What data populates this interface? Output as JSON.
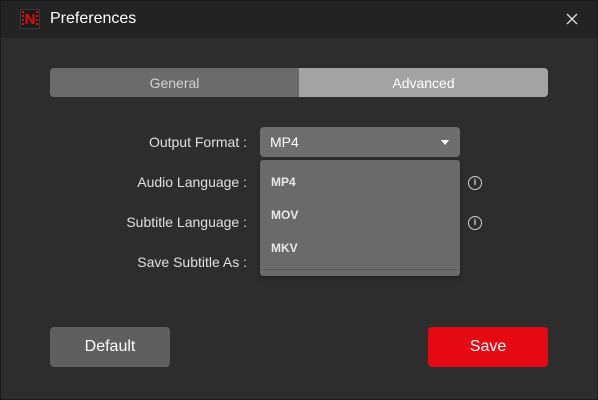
{
  "window": {
    "title": "Preferences",
    "app_icon_letter": "N",
    "close_symbol": "×"
  },
  "tabs": [
    {
      "label": "General",
      "active": false
    },
    {
      "label": "Advanced",
      "active": true
    }
  ],
  "form": {
    "output_format_label": "Output Format :",
    "output_format_value": "MP4",
    "audio_language_label": "Audio Language :",
    "subtitle_language_label": "Subtitle Language :",
    "save_subtitle_label": "Save Subtitle As :",
    "info_symbol": "i"
  },
  "dropdown": {
    "options": [
      "MP4",
      "MOV",
      "MKV"
    ]
  },
  "buttons": {
    "default_label": "Default",
    "save_label": "Save"
  },
  "colors": {
    "accent": "#e50914",
    "background": "#2d2d2d",
    "titlebar": "#232323"
  }
}
